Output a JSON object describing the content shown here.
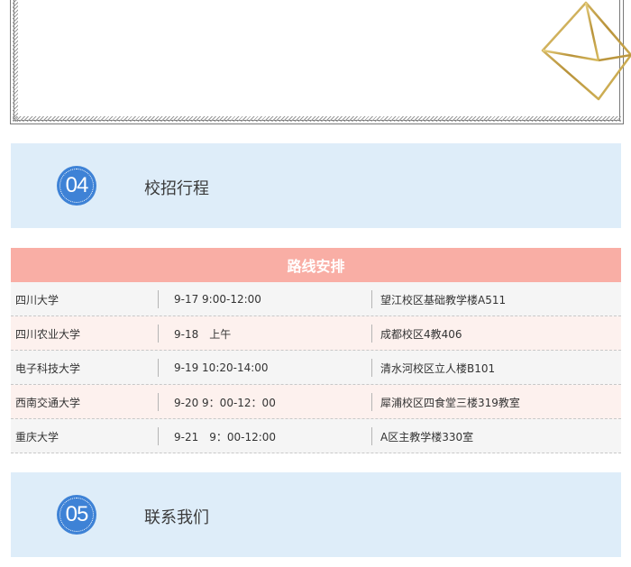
{
  "section_04": {
    "number": "04",
    "title": "校招行程"
  },
  "route": {
    "title": "路线安排",
    "rows": [
      {
        "school": "四川大学",
        "time": "9-17 9:00-12:00",
        "place": "望江校区基础教学楼A511"
      },
      {
        "school": "四川农业大学",
        "time": "9-18　上午",
        "place": "成都校区4教406"
      },
      {
        "school": "电子科技大学",
        "time": "9-19 10:20-14:00",
        "place": "清水河校区立人楼B101"
      },
      {
        "school": "西南交通大学",
        "time": "9-20 9：00-12：00",
        "place": "犀浦校区四食堂三楼319教室"
      },
      {
        "school": "重庆大学",
        "time": "9-21　9：00-12:00",
        "place": " A区主教学楼330室"
      }
    ]
  },
  "section_05": {
    "number": "05",
    "title": "联系我们"
  },
  "colors": {
    "band": "#deedf9",
    "badge": "#3e82d6",
    "route_header": "#f9aea5",
    "row_odd": "#f5f5f5",
    "row_even": "#fdf1ee",
    "diamond_gold": "#c9a94a"
  },
  "icons": {
    "decoration": "gold-diamond-icon"
  }
}
